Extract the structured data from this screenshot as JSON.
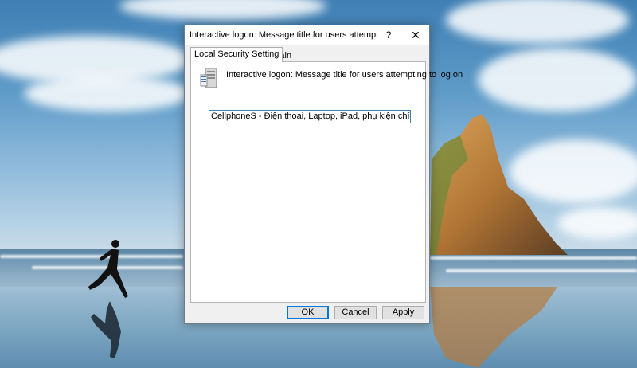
{
  "dialog": {
    "title": "Interactive logon: Message title for users attempting to lo...",
    "help_label": "?",
    "close_label": "✕",
    "tabs": [
      {
        "label": "Local Security Setting",
        "active": true
      },
      {
        "label": "Explain",
        "active": false
      }
    ],
    "policy_description": "Interactive logon: Message title for users attempting to log on",
    "policy_icon": "server-policy-icon",
    "input_value": "CellphoneS - Điện thoại, Laptop, iPad, phụ kiện chính hãng ...",
    "buttons": {
      "ok": "OK",
      "cancel": "Cancel",
      "apply": "Apply"
    }
  },
  "colors": {
    "focus_border": "#0078d7",
    "dialog_bg": "#f0f0f0"
  }
}
